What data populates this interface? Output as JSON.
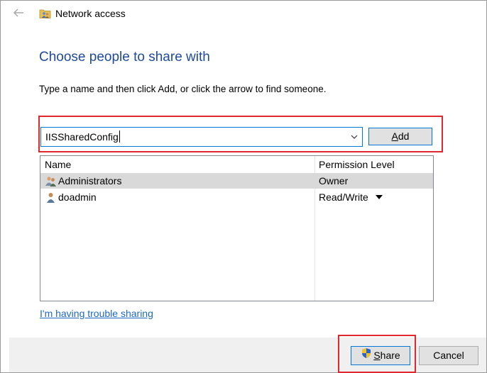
{
  "window": {
    "title": "Network access"
  },
  "dialog": {
    "heading": "Choose people to share with",
    "instructions": "Type a name and then click Add, or click the arrow to find someone.",
    "name_input": {
      "value": "IISSharedConfig"
    },
    "add_button": {
      "label_prefix": "",
      "label_underlined": "A",
      "label_rest": "dd"
    }
  },
  "list": {
    "columns": [
      "Name",
      "Permission Level"
    ],
    "rows": [
      {
        "name": "Administrators",
        "permission": "Owner",
        "icon": "group-users-icon",
        "selected": true
      },
      {
        "name": "doadmin",
        "permission": "Read/Write",
        "icon": "user-icon",
        "selected": false,
        "has_dropdown": true
      }
    ]
  },
  "links": {
    "trouble": "I'm having trouble sharing"
  },
  "footer": {
    "share_button": {
      "label_underlined": "S",
      "label_rest": "hare",
      "icon": "uac-shield-icon"
    },
    "cancel_button": {
      "label": "Cancel"
    }
  },
  "colors": {
    "heading": "#1e4a9c",
    "link": "#1c68c4",
    "highlight_box": "#e0282e",
    "focus_border": "#0078d7",
    "selected_row": "#d9d9d9"
  }
}
